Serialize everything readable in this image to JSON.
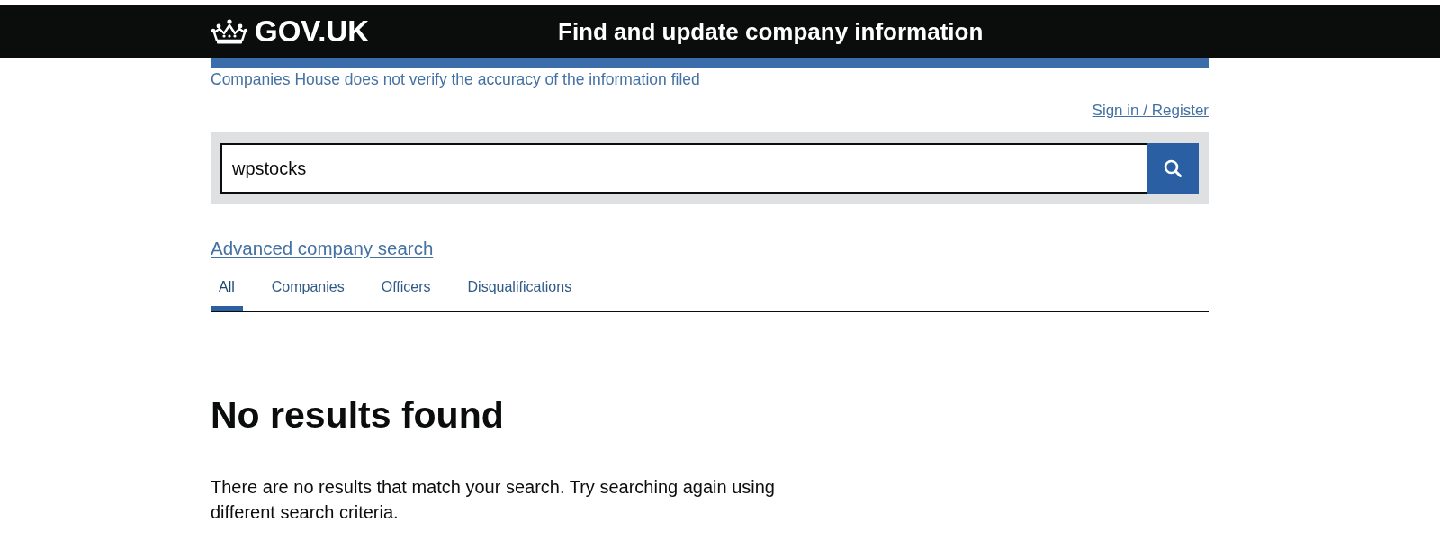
{
  "header": {
    "logo": "GOV.UK",
    "service_name": "Find and update company information"
  },
  "disclaimer_link": "Companies House does not verify the accuracy of the information filed",
  "sign_in_link": "Sign in / Register",
  "search": {
    "value": "wpstocks"
  },
  "advanced_search_link": "Advanced company search",
  "tabs": [
    {
      "label": "All",
      "selected": true
    },
    {
      "label": "Companies",
      "selected": false
    },
    {
      "label": "Officers",
      "selected": false
    },
    {
      "label": "Disqualifications",
      "selected": false
    }
  ],
  "results": {
    "heading": "No results found",
    "message": "There are no results that match your search. Try searching again using different search criteria."
  }
}
